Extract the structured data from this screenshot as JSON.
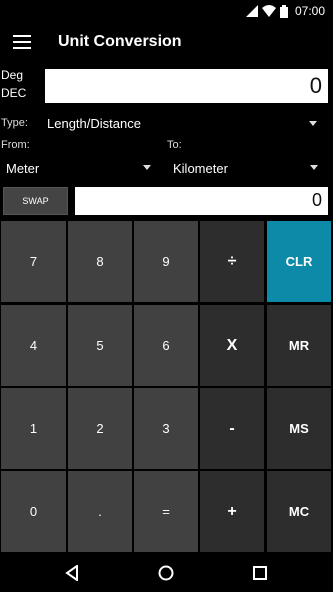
{
  "status_bar": {
    "time": "07:00",
    "icons": [
      "signal-icon",
      "wifi-icon",
      "battery-icon"
    ]
  },
  "app_bar": {
    "title": "Unit Conversion",
    "menu_icon": "menu-icon"
  },
  "mode": {
    "angle": "Deg",
    "base": "DEC"
  },
  "main_input": {
    "value": "0"
  },
  "type": {
    "label": "Type:",
    "value": "Length/Distance"
  },
  "from": {
    "label": "From:",
    "value": "Meter"
  },
  "to": {
    "label": "To:",
    "value": "Kilometer"
  },
  "swap": {
    "label": "SWAP"
  },
  "second_input": {
    "value": "0"
  },
  "keypad": {
    "rows": [
      [
        "7",
        "8",
        "9",
        "÷",
        "CLR"
      ],
      [
        "4",
        "5",
        "6",
        "X",
        "MR"
      ],
      [
        "1",
        "2",
        "3",
        "-",
        "MS"
      ],
      [
        "0",
        ".",
        "=",
        "+",
        "MC"
      ]
    ]
  },
  "colors": {
    "accent": "#0d8aa8",
    "key_dark": "#414141",
    "key_darker": "#2d2d2d"
  },
  "nav_bar": {
    "icons": [
      "back-icon",
      "home-icon",
      "recents-icon"
    ]
  }
}
